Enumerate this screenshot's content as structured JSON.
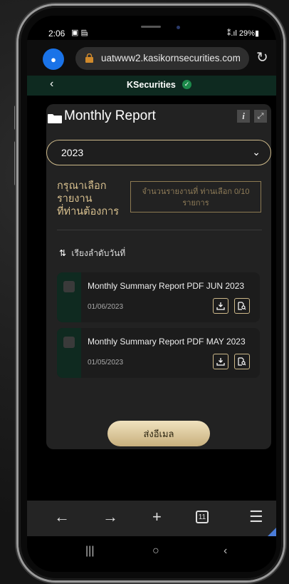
{
  "status": {
    "time": "2:06",
    "left_icons": "▣ ▤",
    "right_text": "⁑.ıl 29%▮"
  },
  "browser": {
    "url": "uatwww2.kasikornsecurities.com"
  },
  "app": {
    "back": "‹",
    "brand": "KSecurities"
  },
  "page": {
    "title": "Monthly Report"
  },
  "year_select": {
    "value": "2023"
  },
  "selection": {
    "label_lines": [
      "กรุณาเลือก",
      "รายงาน",
      "ที่ท่านต้องการ"
    ],
    "count_line1": "จำนวนรายงานที่ ท่านเลือก 0/10",
    "count_line2": "รายการ"
  },
  "sort": {
    "label": "เรียงลำดับวันที่"
  },
  "reports": [
    {
      "name": "Monthly Summary Report PDF JUN 2023",
      "date": "01/06/2023"
    },
    {
      "name": "Monthly Summary Report PDF MAY 2023",
      "date": "01/05/2023"
    }
  ],
  "send_button": {
    "label": "ส่งอีเมล"
  },
  "tabs": {
    "count": "11"
  },
  "colors": {
    "accent": "#cdb98a",
    "header": "#0e2a20",
    "card": "#222222"
  }
}
